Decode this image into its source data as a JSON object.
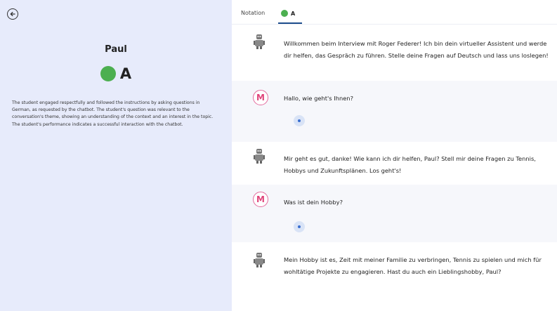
{
  "student": {
    "name": "Paul",
    "grade": "A",
    "grade_color": "#4caf50",
    "summary": "The student engaged respectfully and followed the instructions by asking questions in German, as requested by the chatbot. The student's question was relevant to the conversation's theme, showing an understanding of the context and an interest in the topic. The student's performance indicates a successful interaction with the chatbot."
  },
  "tabs": {
    "notation_label": "Notation",
    "grade_label": "A"
  },
  "icons": {
    "back": "back-arrow-icon",
    "assistant": "robot-icon",
    "user": "m-avatar-icon",
    "play": "play-audio-icon"
  },
  "user_avatar_letter": "M",
  "messages": [
    {
      "role": "assistant",
      "text": "Willkommen beim Interview mit Roger Federer! Ich bin dein virtueller Assistent und werde dir helfen, das Gespräch zu führen. Stelle deine Fragen auf Deutsch und lass uns loslegen!"
    },
    {
      "role": "user",
      "text": "Hallo, wie geht's Ihnen?"
    },
    {
      "role": "assistant",
      "text": "Mir geht es gut, danke! Wie kann ich dir helfen, Paul? Stell mir deine Fragen zu Tennis, Hobbys und Zukunftsplänen. Los geht's!"
    },
    {
      "role": "user",
      "text": "Was ist dein Hobby?"
    },
    {
      "role": "assistant",
      "text": "Mein Hobby ist es, Zeit mit meiner Familie zu verbringen, Tennis zu spielen und mich für wohltätige Projekte zu engagieren. Hast du auch ein Lieblingshobby, Paul?"
    }
  ]
}
